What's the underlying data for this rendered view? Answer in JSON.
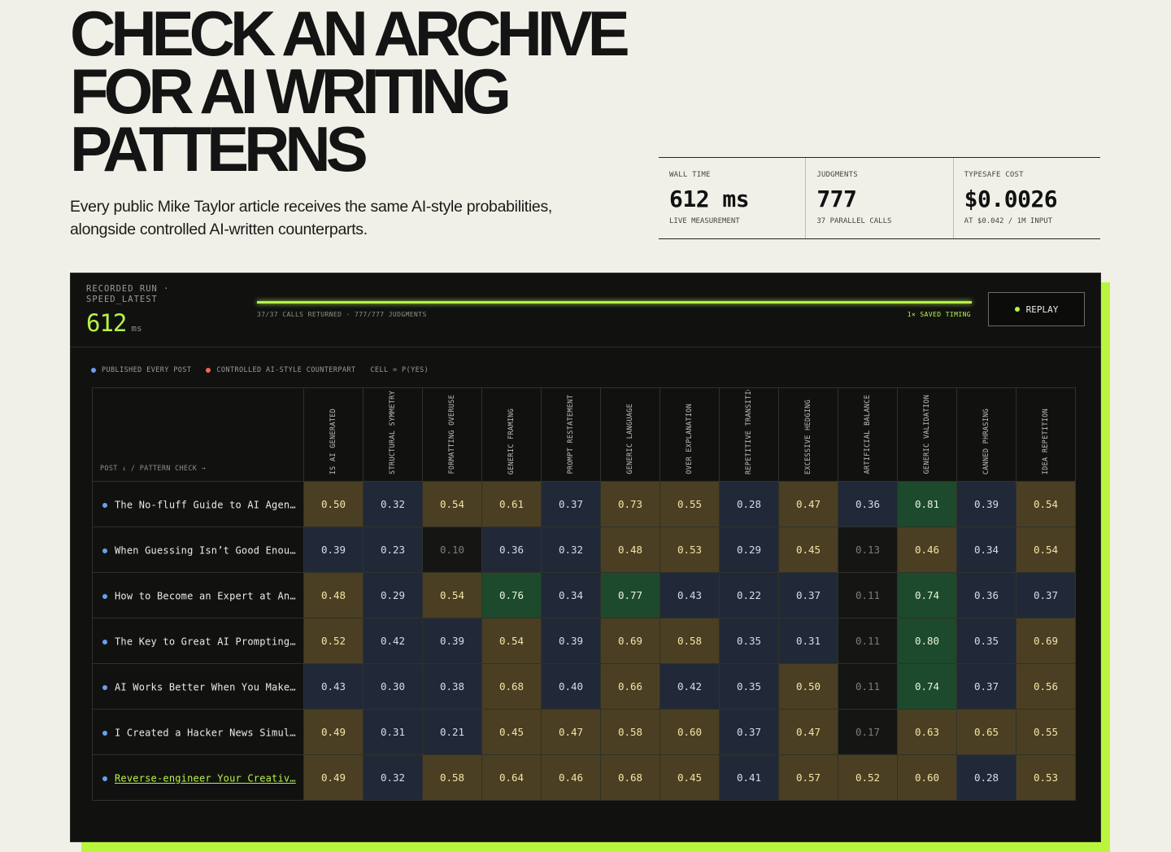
{
  "hero": {
    "title_lines": [
      "CHECK AN ARCHIVE",
      "FOR AI WRITING",
      "PATTERNS"
    ],
    "subtitle": "Every public Mike Taylor article receives the same AI-style probabilities, alongside controlled AI-written counterparts."
  },
  "stats": [
    {
      "label": "WALL TIME",
      "value": "612 ms",
      "sub": "LIVE MEASUREMENT"
    },
    {
      "label": "JUDGMENTS",
      "value": "777",
      "sub": "37 PARALLEL CALLS"
    },
    {
      "label": "TYPESAFE COST",
      "value": "$0.0026",
      "sub": "AT $0.042 / 1M INPUT"
    }
  ],
  "run": {
    "label": "RECORDED RUN · SPEED_LATEST",
    "ms": "612",
    "unit": "ms",
    "progress": 1.0,
    "progress_left": "37/37 CALLS RETURNED · 777/777 JUDGMENTS",
    "progress_right": "1× SAVED TIMING",
    "replay_label": "REPLAY"
  },
  "legend": {
    "published": "PUBLISHED EVERY POST",
    "controlled": "CONTROLLED AI-STYLE COUNTERPART",
    "cell": "CELL = P(YES)",
    "published_color": "#6a9ff0",
    "controlled_color": "#f0675a"
  },
  "matrix": {
    "corner": "POST ↓ / PATTERN CHECK →",
    "columns": [
      "IS AI GENERATED",
      "STRUCTURAL SYMMETRY",
      "FORMATTING OVERUSE",
      "GENERIC FRAMING",
      "PROMPT RESTATEMENT",
      "GENERIC LANGUAGE",
      "OVER EXPLANATION",
      "REPETITIVE TRANSITIO",
      "EXCESSIVE HEDGING",
      "ARTIFICIAL BALANCE",
      "GENERIC VALIDATION",
      "CANNED PHRASING",
      "IDEA REPETITION"
    ],
    "rows": [
      {
        "title": "The No-fluff Guide to AI Agen…",
        "link": false,
        "values": [
          "0.50",
          "0.32",
          "0.54",
          "0.61",
          "0.37",
          "0.73",
          "0.55",
          "0.28",
          "0.47",
          "0.36",
          "0.81",
          "0.39",
          "0.54"
        ]
      },
      {
        "title": "When Guessing Isn’t Good Enou…",
        "link": false,
        "values": [
          "0.39",
          "0.23",
          "0.10",
          "0.36",
          "0.32",
          "0.48",
          "0.53",
          "0.29",
          "0.45",
          "0.13",
          "0.46",
          "0.34",
          "0.54"
        ]
      },
      {
        "title": "How to Become an Expert at An…",
        "link": false,
        "values": [
          "0.48",
          "0.29",
          "0.54",
          "0.76",
          "0.34",
          "0.77",
          "0.43",
          "0.22",
          "0.37",
          "0.11",
          "0.74",
          "0.36",
          "0.37"
        ]
      },
      {
        "title": "The Key to Great AI Prompting…",
        "link": false,
        "values": [
          "0.52",
          "0.42",
          "0.39",
          "0.54",
          "0.39",
          "0.69",
          "0.58",
          "0.35",
          "0.31",
          "0.11",
          "0.80",
          "0.35",
          "0.69"
        ]
      },
      {
        "title": "AI Works Better When You Make…",
        "link": false,
        "values": [
          "0.43",
          "0.30",
          "0.38",
          "0.68",
          "0.40",
          "0.66",
          "0.42",
          "0.35",
          "0.50",
          "0.11",
          "0.74",
          "0.37",
          "0.56"
        ]
      },
      {
        "title": "I Created a Hacker News Simul…",
        "link": false,
        "values": [
          "0.49",
          "0.31",
          "0.21",
          "0.45",
          "0.47",
          "0.58",
          "0.60",
          "0.37",
          "0.47",
          "0.17",
          "0.63",
          "0.65",
          "0.55"
        ]
      },
      {
        "title": "Reverse-engineer Your Creativ…",
        "link": true,
        "values": [
          "0.49",
          "0.32",
          "0.58",
          "0.64",
          "0.46",
          "0.68",
          "0.45",
          "0.41",
          "0.57",
          "0.52",
          "0.60",
          "0.28",
          "0.53"
        ]
      }
    ]
  }
}
